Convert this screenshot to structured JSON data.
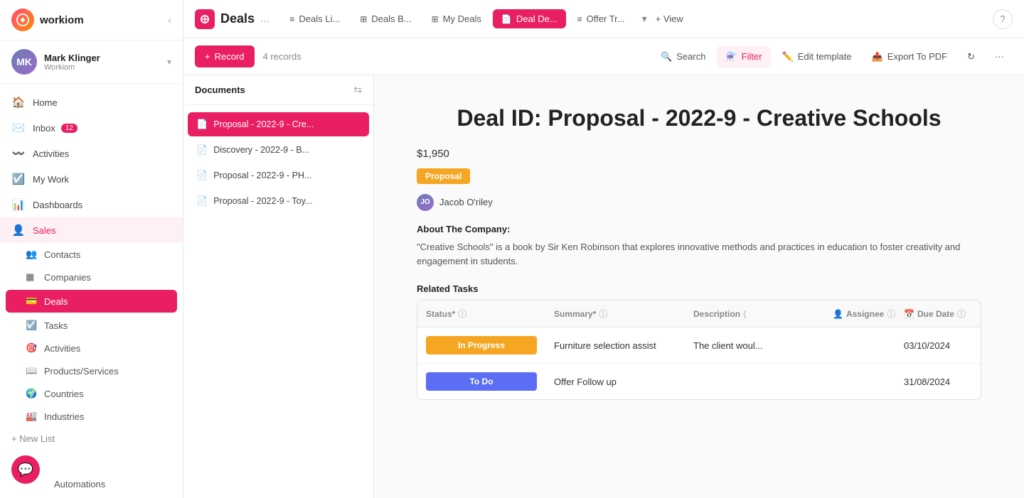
{
  "brand": {
    "name": "workiom"
  },
  "user": {
    "name": "Mark Klinger",
    "org": "Workiom",
    "initials": "MK"
  },
  "sidebar": {
    "nav_items": [
      {
        "id": "home",
        "label": "Home",
        "icon": "🏠",
        "active": false
      },
      {
        "id": "inbox",
        "label": "Inbox",
        "icon": "✉️",
        "active": false,
        "badge": "12"
      },
      {
        "id": "activities",
        "label": "Activities",
        "icon": "〰️",
        "active": false
      },
      {
        "id": "my-work",
        "label": "My Work",
        "icon": "☑️",
        "active": false
      },
      {
        "id": "dashboards",
        "label": "Dashboards",
        "icon": "📊",
        "active": false
      },
      {
        "id": "sales",
        "label": "Sales",
        "icon": "👤",
        "active": true
      }
    ],
    "sub_items": [
      {
        "id": "contacts",
        "label": "Contacts",
        "icon": "👥",
        "active": false
      },
      {
        "id": "companies",
        "label": "Companies",
        "icon": "▦",
        "active": false
      },
      {
        "id": "deals",
        "label": "Deals",
        "icon": "💳",
        "active": true
      },
      {
        "id": "tasks",
        "label": "Tasks",
        "icon": "☑️",
        "active": false
      },
      {
        "id": "activities-sub",
        "label": "Activities",
        "icon": "🎯",
        "active": false
      },
      {
        "id": "products-services",
        "label": "Products/Services",
        "icon": "📖",
        "active": false
      },
      {
        "id": "countries",
        "label": "Countries",
        "icon": "🌍",
        "active": false
      },
      {
        "id": "industries",
        "label": "Industries",
        "icon": "🏭",
        "active": false
      }
    ],
    "new_list": "+ New List",
    "automations": "Automations"
  },
  "top_nav": {
    "section_title": "Deals",
    "dots_label": "...",
    "tabs": [
      {
        "id": "deals-list",
        "label": "Deals Li...",
        "icon": "≡",
        "active": false
      },
      {
        "id": "deals-board",
        "label": "Deals B...",
        "icon": "⊞",
        "active": false
      },
      {
        "id": "my-deals",
        "label": "My Deals",
        "icon": "⊞",
        "active": false
      },
      {
        "id": "deal-detail",
        "label": "Deal De...",
        "icon": "📄",
        "active": true
      },
      {
        "id": "offer-template",
        "label": "Offer Tr...",
        "icon": "≡",
        "active": false
      }
    ],
    "add_view": "+ View",
    "help": "?"
  },
  "toolbar": {
    "record_label": "Record",
    "records_count": "4 records",
    "search_label": "Search",
    "filter_label": "Filter",
    "edit_template_label": "Edit template",
    "export_label": "Export To PDF"
  },
  "documents": {
    "title": "Documents",
    "items": [
      {
        "id": "doc1",
        "label": "Proposal - 2022-9 - Cre...",
        "active": true
      },
      {
        "id": "doc2",
        "label": "Discovery - 2022-9 - B...",
        "active": false
      },
      {
        "id": "doc3",
        "label": "Proposal - 2022-9 - PH...",
        "active": false
      },
      {
        "id": "doc4",
        "label": "Proposal - 2022-9 - Toy...",
        "active": false
      }
    ]
  },
  "deal": {
    "title": "Deal ID: Proposal - 2022-9 - Creative Schools",
    "amount": "$1,950",
    "badge": "Proposal",
    "assignee": "Jacob O'riley",
    "about_title": "About The Company:",
    "about_text": "\"Creative Schools\" is a book by Sir Ken Robinson that explores innovative methods and practices in education to foster creativity and engagement in students.",
    "related_tasks_title": "Related Tasks",
    "tasks_headers": {
      "status": "Status*",
      "summary": "Summary*",
      "description": "Description",
      "assignee": "Assignee",
      "due_date": "Due Date"
    },
    "tasks": [
      {
        "status": "In Progress",
        "status_type": "inprogress",
        "summary": "Furniture selection assist",
        "description": "The client woul...",
        "assignee": "",
        "due_date": "03/10/2024"
      },
      {
        "status": "To Do",
        "status_type": "todo",
        "summary": "Offer Follow up",
        "description": "",
        "assignee": "",
        "due_date": "31/08/2024"
      }
    ]
  }
}
